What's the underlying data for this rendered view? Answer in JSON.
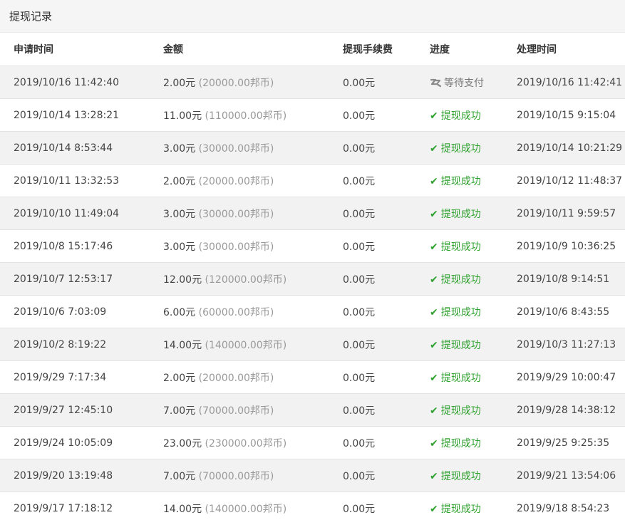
{
  "title": "提现记录",
  "colors": {
    "success": "#2ea12e",
    "muted": "#999999",
    "stripe": "#f2f2f2"
  },
  "table": {
    "headers": [
      "申请时间",
      "金额",
      "提现手续费",
      "进度",
      "处理时间"
    ],
    "rows": [
      {
        "applied": "2019/10/16 11:42:40",
        "amount": "2.00元",
        "bangbi": "(20000.00邦币)",
        "fee": "0.00元",
        "status": "等待支付",
        "status_type": "pending",
        "status_icon": "pending-payment-icon",
        "processed": "2019/10/16 11:42:41"
      },
      {
        "applied": "2019/10/14 13:28:21",
        "amount": "11.00元",
        "bangbi": "(110000.00邦币)",
        "fee": "0.00元",
        "status": "提现成功",
        "status_type": "success",
        "status_icon": "check-icon",
        "processed": "2019/10/15 9:15:04"
      },
      {
        "applied": "2019/10/14 8:53:44",
        "amount": "3.00元",
        "bangbi": "(30000.00邦币)",
        "fee": "0.00元",
        "status": "提现成功",
        "status_type": "success",
        "status_icon": "check-icon",
        "processed": "2019/10/14 10:21:29"
      },
      {
        "applied": "2019/10/11 13:32:53",
        "amount": "2.00元",
        "bangbi": "(20000.00邦币)",
        "fee": "0.00元",
        "status": "提现成功",
        "status_type": "success",
        "status_icon": "check-icon",
        "processed": "2019/10/12 11:48:37"
      },
      {
        "applied": "2019/10/10 11:49:04",
        "amount": "3.00元",
        "bangbi": "(30000.00邦币)",
        "fee": "0.00元",
        "status": "提现成功",
        "status_type": "success",
        "status_icon": "check-icon",
        "processed": "2019/10/11 9:59:57"
      },
      {
        "applied": "2019/10/8 15:17:46",
        "amount": "3.00元",
        "bangbi": "(30000.00邦币)",
        "fee": "0.00元",
        "status": "提现成功",
        "status_type": "success",
        "status_icon": "check-icon",
        "processed": "2019/10/9 10:36:25"
      },
      {
        "applied": "2019/10/7 12:53:17",
        "amount": "12.00元",
        "bangbi": "(120000.00邦币)",
        "fee": "0.00元",
        "status": "提现成功",
        "status_type": "success",
        "status_icon": "check-icon",
        "processed": "2019/10/8 9:14:51"
      },
      {
        "applied": "2019/10/6 7:03:09",
        "amount": "6.00元",
        "bangbi": "(60000.00邦币)",
        "fee": "0.00元",
        "status": "提现成功",
        "status_type": "success",
        "status_icon": "check-icon",
        "processed": "2019/10/6 8:43:55"
      },
      {
        "applied": "2019/10/2 8:19:22",
        "amount": "14.00元",
        "bangbi": "(140000.00邦币)",
        "fee": "0.00元",
        "status": "提现成功",
        "status_type": "success",
        "status_icon": "check-icon",
        "processed": "2019/10/3 11:27:13"
      },
      {
        "applied": "2019/9/29 7:17:34",
        "amount": "2.00元",
        "bangbi": "(20000.00邦币)",
        "fee": "0.00元",
        "status": "提现成功",
        "status_type": "success",
        "status_icon": "check-icon",
        "processed": "2019/9/29 10:00:47"
      },
      {
        "applied": "2019/9/27 12:45:10",
        "amount": "7.00元",
        "bangbi": "(70000.00邦币)",
        "fee": "0.00元",
        "status": "提现成功",
        "status_type": "success",
        "status_icon": "check-icon",
        "processed": "2019/9/28 14:38:12"
      },
      {
        "applied": "2019/9/24 10:05:09",
        "amount": "23.00元",
        "bangbi": "(230000.00邦币)",
        "fee": "0.00元",
        "status": "提现成功",
        "status_type": "success",
        "status_icon": "check-icon",
        "processed": "2019/9/25 9:25:35"
      },
      {
        "applied": "2019/9/20 13:19:48",
        "amount": "7.00元",
        "bangbi": "(70000.00邦币)",
        "fee": "0.00元",
        "status": "提现成功",
        "status_type": "success",
        "status_icon": "check-icon",
        "processed": "2019/9/21 13:54:06"
      },
      {
        "applied": "2019/9/17 17:18:12",
        "amount": "14.00元",
        "bangbi": "(140000.00邦币)",
        "fee": "0.00元",
        "status": "提现成功",
        "status_type": "success",
        "status_icon": "check-icon",
        "processed": "2019/9/18 8:54:23"
      }
    ]
  }
}
